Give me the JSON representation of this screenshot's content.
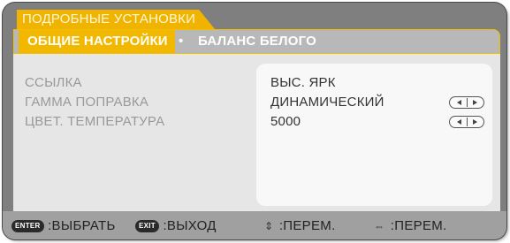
{
  "menu": {
    "title": "ПОДРОБНЫЕ УСТАНОВКИ",
    "tabs": [
      {
        "label": "ОБЩИЕ НАСТРОЙКИ",
        "active": true
      },
      {
        "label": "БАЛАНС БЕЛОГО",
        "active": false
      }
    ],
    "separator": "•"
  },
  "settings": [
    {
      "label": "ССЫЛКА",
      "value": "ВЫС. ЯРК",
      "adjustable": false
    },
    {
      "label": "ГАММА ПОПРАВКА",
      "value": "ДИНАМИЧЕСКИЙ",
      "adjustable": true
    },
    {
      "label": "ЦВЕТ. ТЕМПЕРАТУРА",
      "value": "5000",
      "adjustable": true
    }
  ],
  "footer": {
    "enter_key": "ENTER",
    "enter_text": ":ВЫБРАТЬ",
    "exit_key": "EXIT",
    "exit_text": ":ВЫХОД",
    "updown_icon": "updown-arrows-icon",
    "updown_text": ":ПЕРЕМ.",
    "leftright_icon": "leftright-arrows-icon",
    "leftright_text": ":ПЕРЕМ."
  },
  "colors": {
    "accent": "#f2b800",
    "frame": "#7f7f7f",
    "content_bg": "#e6e6e6"
  }
}
